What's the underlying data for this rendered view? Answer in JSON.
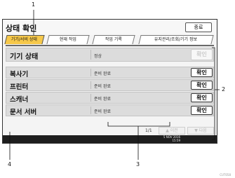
{
  "window": {
    "title": "상태 확인",
    "close_label": "종료"
  },
  "tabs": [
    {
      "label": "기기/서비 상태",
      "active": true
    },
    {
      "label": "현재 작업",
      "active": false
    },
    {
      "label": "작업 기록",
      "active": false
    },
    {
      "label": "유지관리/조회/기기 정보",
      "active": false
    }
  ],
  "rows": [
    {
      "label": "기기 상태",
      "status": "정상",
      "button": "확인",
      "button_enabled": false
    },
    {
      "label": "복사기",
      "status": "준비 완료",
      "button": "확인",
      "button_enabled": true
    },
    {
      "label": "프린터",
      "status": "준비 완료",
      "button": "확인",
      "button_enabled": true
    },
    {
      "label": "스캐너",
      "status": "준비 완료",
      "button": "확인",
      "button_enabled": true
    },
    {
      "label": "문서 서버",
      "status": "준비 완료",
      "button": "확인",
      "button_enabled": true
    }
  ],
  "pager": {
    "text": "1/1",
    "prev_label": "▲ 이전",
    "next_label": "▼ 다음"
  },
  "status_bar": {
    "date": "5 NOV 2016",
    "time": "15:59"
  },
  "callouts": [
    "1",
    "2",
    "3",
    "4"
  ],
  "figure_code": "CUT058",
  "colors": {
    "active_tab": "#f6c84a",
    "row_bg": "#dcdcdc",
    "bottom_bar": "#1e1e1e"
  }
}
